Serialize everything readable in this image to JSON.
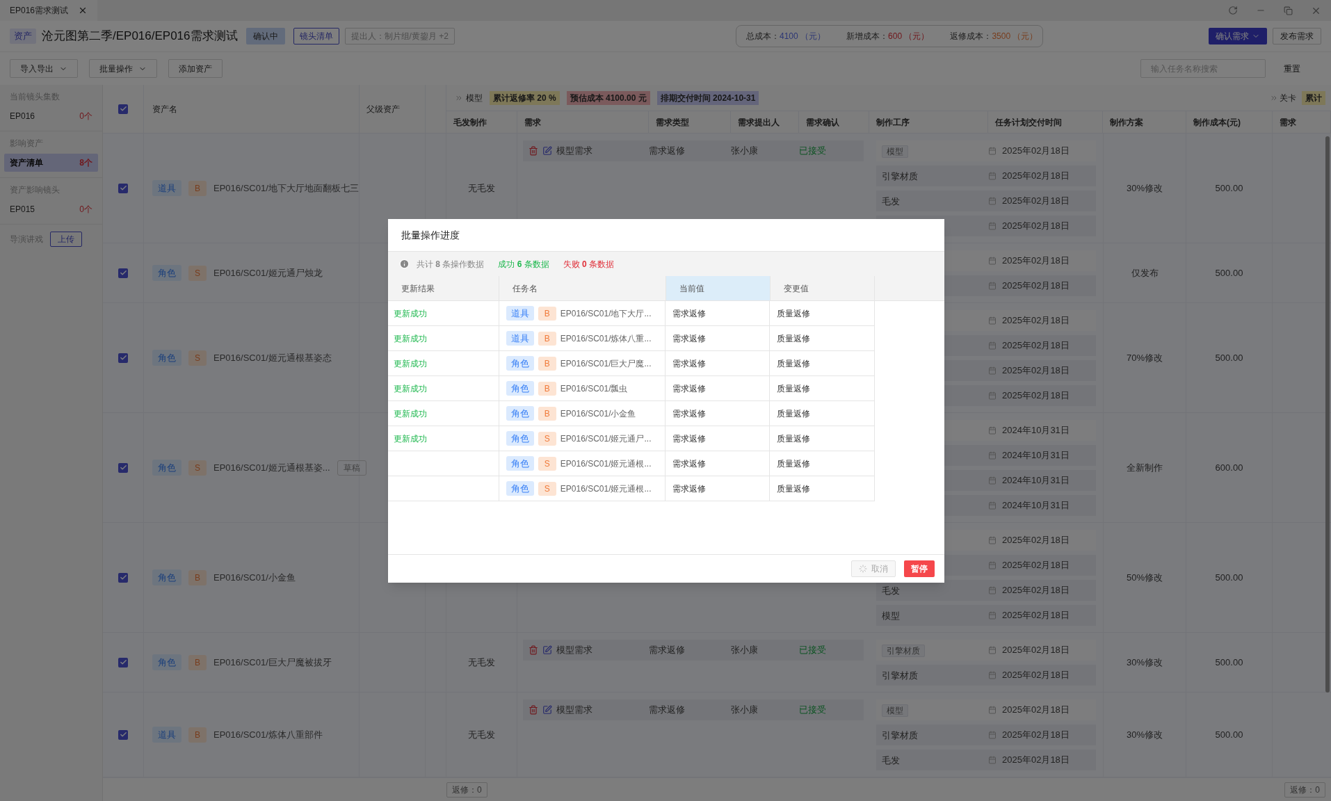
{
  "tab": {
    "title": "EP016需求测试"
  },
  "header": {
    "type_tag": "资产",
    "breadcrumb": "沧元图第二季/EP016/EP016需求测试",
    "status": "确认中",
    "shot_list": "镜头清单",
    "proposer": "提出人：制片组/黄鋆月 +2"
  },
  "costs": [
    {
      "label": "总成本：",
      "value": "4100",
      "unit": "（元）",
      "kind": "total"
    },
    {
      "label": "新增成本：",
      "value": "600",
      "unit": "（元）",
      "kind": "added"
    },
    {
      "label": "返修成本：",
      "value": "3500",
      "unit": "（元）",
      "kind": "rework"
    }
  ],
  "actions": [
    {
      "label": "确认需求",
      "kind": "primary",
      "dropdown": true
    },
    {
      "label": "发布需求",
      "kind": "default",
      "dropdown": false
    }
  ],
  "toolbar": {
    "buttons": [
      {
        "label": "导入导出",
        "dropdown": true
      },
      {
        "label": "批量操作",
        "dropdown": true
      },
      {
        "label": "添加资产",
        "dropdown": false
      }
    ],
    "search": {
      "placeholder": "输入任务名称搜索"
    },
    "reset": "重置"
  },
  "sidebar": {
    "sections": [
      {
        "title": "当前镜头集数",
        "items": [
          {
            "label": "EP016",
            "count": "0个",
            "selected": false
          }
        ]
      },
      {
        "title": "影响资产",
        "items": [
          {
            "label": "资产清单",
            "count": "8个",
            "selected": true
          }
        ]
      },
      {
        "title": "资产影响镜头",
        "items": [
          {
            "label": "EP015",
            "count": "0个",
            "selected": false
          }
        ]
      }
    ],
    "director": {
      "label": "导演讲戏",
      "button": "上传"
    }
  },
  "table": {
    "all_checked": true,
    "groups": [
      {
        "label": "模型",
        "tags": [
          {
            "text": "累计返修率 20 %",
            "kind": "rate"
          },
          {
            "text": "预估成本 4100.00 元",
            "kind": "estimate"
          },
          {
            "text": "排期交付时间 2024-10-31",
            "kind": "schedule"
          }
        ]
      },
      {
        "label": "关卡",
        "tags": [
          {
            "text": "累计",
            "kind": "rate"
          }
        ]
      }
    ],
    "columns": [
      "资产名",
      "父级资产",
      "毛发制作",
      "需求",
      "需求类型",
      "需求提出人",
      "需求确认",
      "制作工序",
      "任务计划交付时间",
      "制作方案",
      "制作成本(元)",
      "需求"
    ],
    "rows": [
      {
        "checked": true,
        "type": "道具",
        "grade": "B",
        "name": "EP016/SC01/地下大厅地面翻板七三",
        "hair": "无毛发",
        "requirement": {
          "name": "模型需求",
          "type": "需求返修",
          "proposer": "张小康",
          "status": "已接受"
        },
        "processes": [
          {
            "name": "模型",
            "date": "2025年02月18日"
          },
          {
            "name": "引擎材质",
            "date": "2025年02月18日"
          },
          {
            "name": "毛发",
            "date": "2025年02月18日"
          },
          {
            "date": "2025年02月18日"
          }
        ],
        "plan": "30%修改",
        "cost": "500.00"
      },
      {
        "checked": true,
        "type": "角色",
        "grade": "S",
        "name": "EP016/SC01/姬元通尸烛龙",
        "processes": [
          {
            "date": "2025年02月18日"
          },
          {
            "date": "2025年02月18日"
          }
        ],
        "plan": "仅发布",
        "cost": "500.00"
      },
      {
        "checked": true,
        "type": "角色",
        "grade": "S",
        "name": "EP016/SC01/姬元通根基姿态",
        "processes": [
          {
            "date": "2025年02月18日"
          },
          {
            "date": "2025年02月18日"
          },
          {
            "date": "2025年02月18日"
          },
          {
            "date": "2025年02月18日"
          }
        ],
        "plan": "70%修改",
        "cost": "500.00"
      },
      {
        "checked": true,
        "type": "角色",
        "grade": "S",
        "name": "EP016/SC01/姬元通根基姿...",
        "draft": "草稿",
        "processes": [
          {
            "date": "2024年10月31日"
          },
          {
            "date": "2024年10月31日"
          },
          {
            "date": "2024年10月31日"
          },
          {
            "date": "2024年10月31日"
          }
        ],
        "plan": "全新制作",
        "cost": "600.00"
      },
      {
        "checked": true,
        "type": "角色",
        "grade": "B",
        "name": "EP016/SC01/小金鱼",
        "processes": [
          {
            "date": "2025年02月18日"
          },
          {
            "date": "2025年02月18日"
          },
          {
            "name": "毛发",
            "date": "2025年02月18日"
          },
          {
            "name": "模型",
            "date": "2025年02月18日"
          }
        ],
        "plan": "50%修改",
        "cost": "500.00"
      },
      {
        "checked": true,
        "type": "角色",
        "grade": "B",
        "name": "EP016/SC01/巨大尸魔被拔牙",
        "hair": "无毛发",
        "requirement": {
          "name": "模型需求",
          "type": "需求返修",
          "proposer": "张小康",
          "status": "已接受"
        },
        "processes": [
          {
            "name": "引擎材质",
            "date": "2025年02月18日"
          },
          {
            "name": "引擎材质",
            "date": "2025年02月18日"
          }
        ],
        "plan": "30%修改",
        "cost": "500.00"
      },
      {
        "checked": true,
        "type": "道具",
        "grade": "B",
        "name": "EP016/SC01/炼体八重部件",
        "hair": "无毛发",
        "requirement": {
          "name": "模型需求",
          "type": "需求返修",
          "proposer": "张小康",
          "status": "已接受"
        },
        "processes": [
          {
            "name": "模型",
            "date": "2025年02月18日"
          },
          {
            "name": "引擎材质",
            "date": "2025年02月18日"
          },
          {
            "name": "毛发",
            "date": "2025年02月18日"
          }
        ],
        "plan": "30%修改",
        "cost": "500.00"
      }
    ],
    "footer": [
      "返修：0",
      "返修：0"
    ]
  },
  "modal": {
    "title": "批量操作进度",
    "summary": {
      "total": "共计 **8** 条操作数据",
      "success": "成功 **6** 条数据",
      "failed": "失败 **0** 条数据"
    },
    "columns": [
      {
        "label": "更新结果",
        "selected": false
      },
      {
        "label": "任务名",
        "selected": false
      },
      {
        "label": "当前值",
        "selected": true
      },
      {
        "label": "变更值",
        "selected": false
      }
    ],
    "rows": [
      {
        "result": "更新成功",
        "type": "道具",
        "grade": "B",
        "name": "EP016/SC01/地下大厅...",
        "current": "需求返修",
        "new": "质量返修"
      },
      {
        "result": "更新成功",
        "type": "道具",
        "grade": "B",
        "name": "EP016/SC01/炼体八重...",
        "current": "需求返修",
        "new": "质量返修"
      },
      {
        "result": "更新成功",
        "type": "角色",
        "grade": "B",
        "name": "EP016/SC01/巨大尸魔...",
        "current": "需求返修",
        "new": "质量返修"
      },
      {
        "result": "更新成功",
        "type": "角色",
        "grade": "B",
        "name": "EP016/SC01/瓢虫",
        "current": "需求返修",
        "new": "质量返修"
      },
      {
        "result": "更新成功",
        "type": "角色",
        "grade": "B",
        "name": "EP016/SC01/小金鱼",
        "current": "需求返修",
        "new": "质量返修"
      },
      {
        "result": "更新成功",
        "type": "角色",
        "grade": "S",
        "name": "EP016/SC01/姬元通尸...",
        "current": "需求返修",
        "new": "质量返修"
      },
      {
        "type": "角色",
        "grade": "S",
        "name": "EP016/SC01/姬元通根...",
        "current": "需求返修",
        "new": "质量返修"
      },
      {
        "type": "角色",
        "grade": "S",
        "name": "EP016/SC01/姬元通根...",
        "current": "需求返修",
        "new": "质量返修"
      }
    ],
    "buttons": [
      {
        "label": "取消",
        "kind": "default",
        "disabled": true,
        "loading": true
      },
      {
        "label": "暂停",
        "kind": "danger",
        "disabled": false,
        "loading": false
      }
    ]
  }
}
